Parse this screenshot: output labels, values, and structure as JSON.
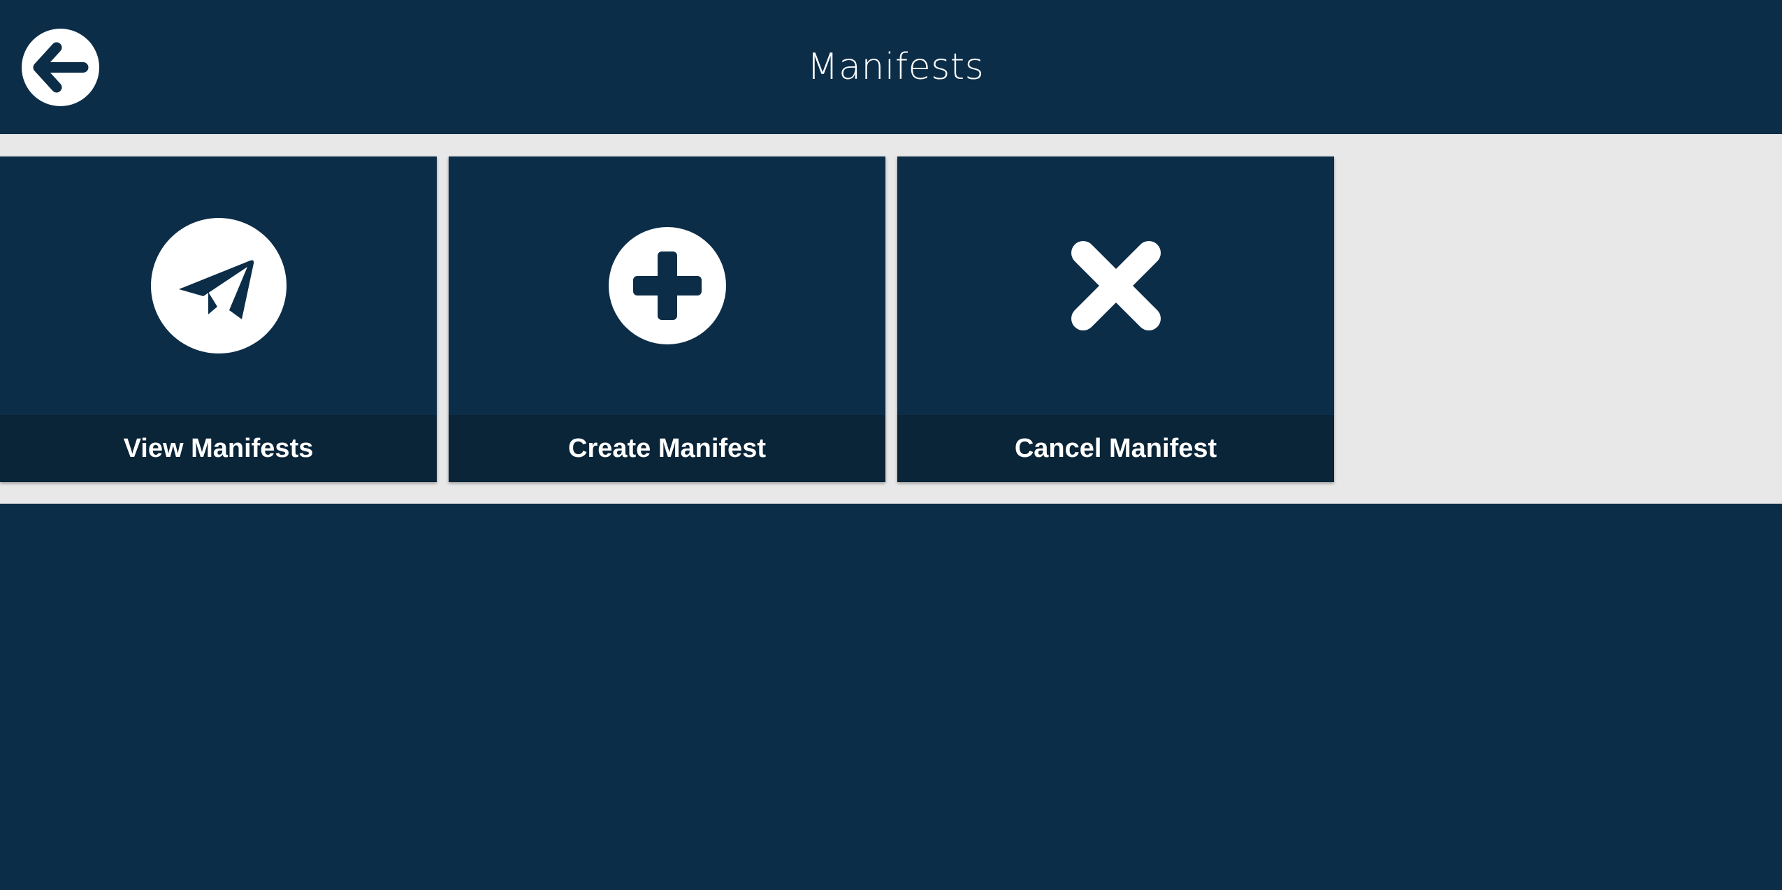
{
  "header": {
    "title": "Manifests",
    "back_icon": "arrow-left-circle-icon"
  },
  "tiles": [
    {
      "label": "View Manifests",
      "icon": "paper-plane-circle-icon"
    },
    {
      "label": "Create Manifest",
      "icon": "plus-circle-icon"
    },
    {
      "label": "Cancel Manifest",
      "icon": "x-icon"
    }
  ],
  "colors": {
    "primary": "#0c2d48",
    "tile_footer": "#0a2438",
    "band_background": "#e8e8e8",
    "icon": "#ffffff"
  }
}
